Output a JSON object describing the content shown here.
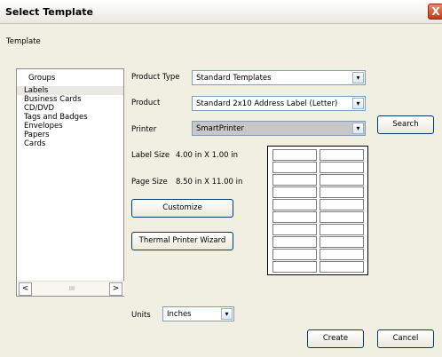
{
  "window": {
    "title": "Select Template",
    "close_glyph": "X"
  },
  "section": {
    "label": "Template"
  },
  "groups": {
    "header": "Groups",
    "items": [
      "Labels",
      "Business Cards",
      "CD/DVD",
      "Tags and Badges",
      "Envelopes",
      "Papers",
      "Cards"
    ],
    "selected": "Labels",
    "scroll_left": "<",
    "scroll_right": ">",
    "scroll_thumb": "III"
  },
  "form": {
    "product_type": {
      "label": "Product Type",
      "value": "Standard Templates"
    },
    "product": {
      "label": "Product",
      "value": "Standard 2x10 Address Label (Letter)"
    },
    "printer": {
      "label": "Printer",
      "value": "SmartPrinter"
    },
    "label_size": {
      "label": "Label Size",
      "value": "4.00 in X 1.00 in"
    },
    "page_size": {
      "label": "Page Size",
      "value": "8.50 in X 11.00 in"
    },
    "units": {
      "label": "Units",
      "value": "Inches"
    }
  },
  "buttons": {
    "search": "Search",
    "customize": "Customize",
    "thermal_wizard": "Thermal Printer Wizard",
    "create": "Create",
    "cancel": "Cancel"
  },
  "preview": {
    "columns": 2,
    "rows": 10
  },
  "icons": {
    "dropdown": "chevron-down-icon",
    "close": "close-icon"
  }
}
